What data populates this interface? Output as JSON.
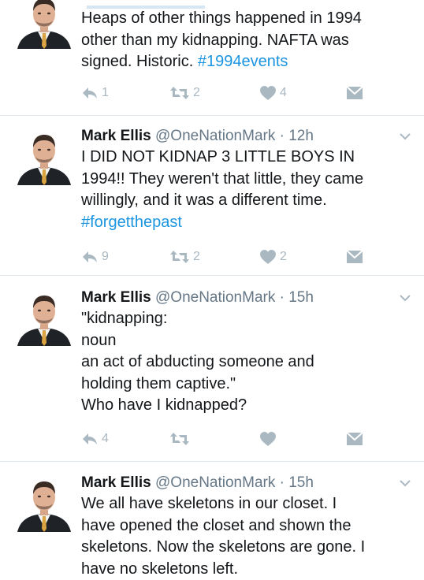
{
  "tweets": [
    {
      "name": "",
      "handle": "",
      "time": "",
      "lines": [
        [
          {
            "t": "Heaps of other things happened in 1994"
          }
        ],
        [
          {
            "t": "other than my kidnapping. NAFTA was"
          }
        ],
        [
          {
            "t": "signed. Historic. "
          },
          {
            "t": "#1994events",
            "h": true
          }
        ]
      ],
      "replies": "1",
      "retweets": "2",
      "likes": "4"
    },
    {
      "name": "Mark Ellis",
      "handle": "@OneNationMark",
      "time": "12h",
      "lines": [
        [
          {
            "t": "I DID NOT KIDNAP 3 LITTLE BOYS IN"
          }
        ],
        [
          {
            "t": "1994!! They weren't that little, they came"
          }
        ],
        [
          {
            "t": "willingly, and it was a different time."
          }
        ],
        [
          {
            "t": "#forgetthepast",
            "h": true
          }
        ]
      ],
      "replies": "9",
      "retweets": "2",
      "likes": "2"
    },
    {
      "name": "Mark Ellis",
      "handle": "@OneNationMark",
      "time": "15h",
      "lines": [
        [
          {
            "t": "\"kidnapping:"
          }
        ],
        [
          {
            "t": "noun"
          }
        ],
        [
          {
            "t": "an act of abducting someone and"
          }
        ],
        [
          {
            "t": "holding them captive.\""
          }
        ],
        [
          {
            "t": "Who have I kidnapped?"
          }
        ]
      ],
      "replies": "4",
      "retweets": "",
      "likes": ""
    },
    {
      "name": "Mark Ellis",
      "handle": "@OneNationMark",
      "time": "15h",
      "lines": [
        [
          {
            "t": "We all have skeletons in our closet. I"
          }
        ],
        [
          {
            "t": "have opened the closet and shown the"
          }
        ],
        [
          {
            "t": "skeletons. Now the skeletons are gone. I"
          }
        ],
        [
          {
            "t": "have no skeletons left."
          }
        ]
      ],
      "replies": "",
      "retweets": "",
      "likes": ""
    }
  ],
  "icons": {
    "reply": "reply-icon",
    "retweet": "retweet-icon",
    "like": "heart-icon",
    "dm": "envelope-icon",
    "more": "chevron-down-icon"
  },
  "colors": {
    "link": "#1b95e0",
    "meta": "#657786",
    "action": "#aab8c2",
    "divider": "#e1e8ed"
  }
}
